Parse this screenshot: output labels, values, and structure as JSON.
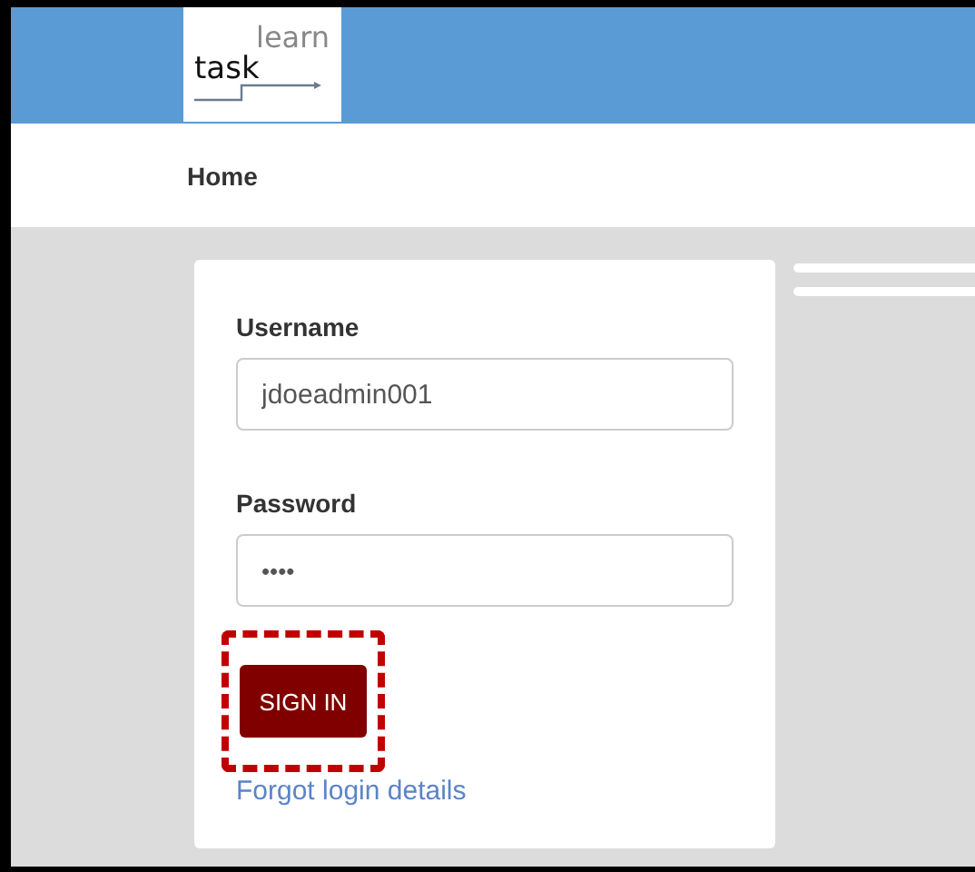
{
  "logo": {
    "word": "task",
    "raised_word": "learn"
  },
  "nav": {
    "items": [
      {
        "label": "Home"
      }
    ]
  },
  "login_form": {
    "username": {
      "label": "Username",
      "value": "jdoeadmin001"
    },
    "password": {
      "label": "Password",
      "value": "••••"
    },
    "sign_in_button": {
      "label": "SIGN IN",
      "focused": true
    },
    "forgot_link": "Forgot login details"
  }
}
